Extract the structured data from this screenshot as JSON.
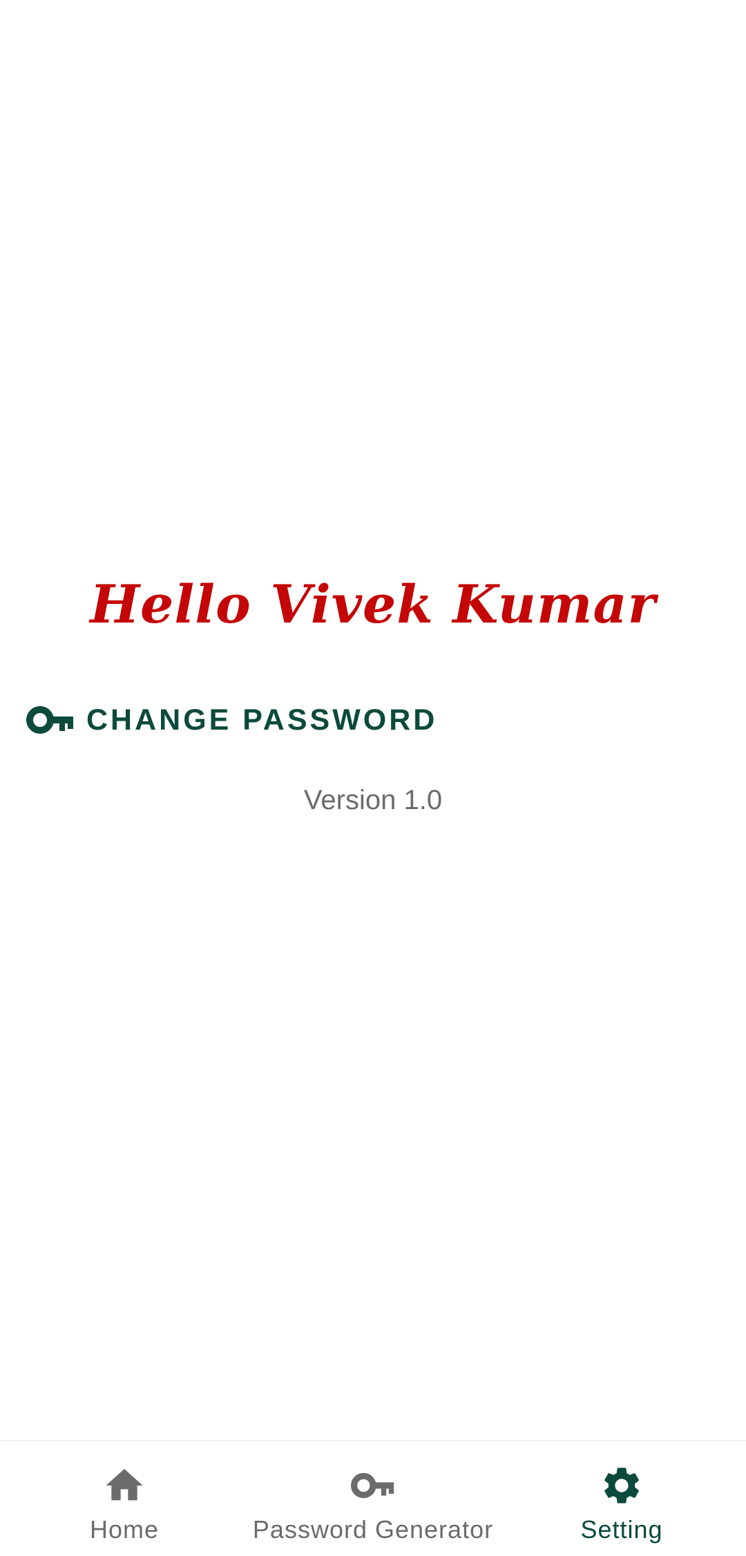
{
  "colors": {
    "greeting": "#c40606",
    "accent": "#0b4a3c",
    "muted": "#6b6b6b",
    "background": "#ffffff"
  },
  "greeting": {
    "text": "Hello Vivek Kumar"
  },
  "settings": {
    "change_password": {
      "icon": "key-icon",
      "label": "CHANGE PASSWORD"
    },
    "version": "Version 1.0"
  },
  "bottom_nav": {
    "selected": "setting",
    "items": [
      {
        "id": "home",
        "icon": "home-icon",
        "label": "Home"
      },
      {
        "id": "password_generator",
        "icon": "key-icon",
        "label": "Password Generator"
      },
      {
        "id": "setting",
        "icon": "gear-icon",
        "label": "Setting"
      }
    ]
  }
}
